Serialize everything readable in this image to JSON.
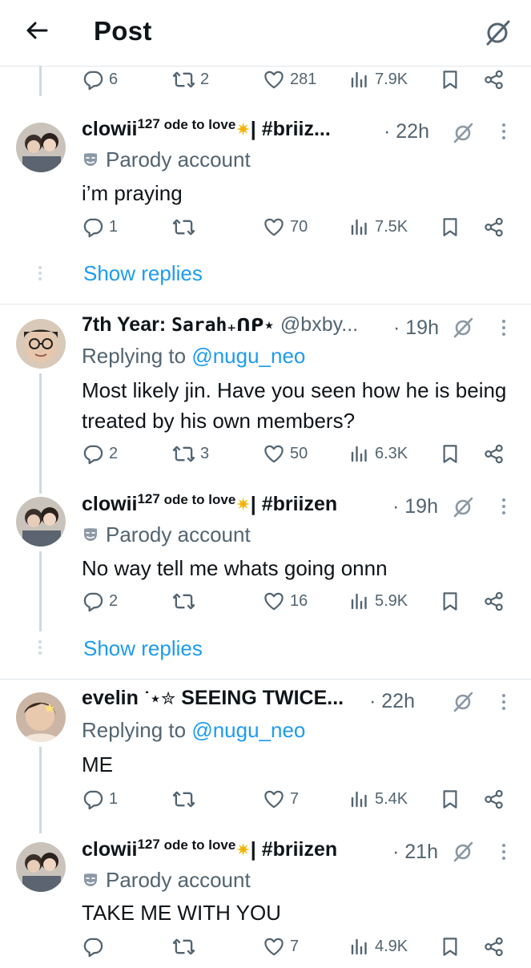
{
  "header": {
    "title": "Post",
    "back_icon": "back-arrow-icon",
    "right_icon": "muted-icon"
  },
  "top_actions": {
    "replies": "6",
    "reposts": "2",
    "likes": "281",
    "views": "7.9K"
  },
  "posts": [
    {
      "name_main": "clowii",
      "name_sup": "127",
      "name_small": " ode to love",
      "name_tail": "| #briiz...",
      "time": "· 22h",
      "sub": "Parody account",
      "text": "i’m praying",
      "replies": "1",
      "reposts": "",
      "likes": "70",
      "views": "7.5K",
      "show_replies": "Show replies"
    },
    {
      "name_main": "7th Year: ",
      "name_fancy": "Sarah",
      "name_fancy2": "₊ᑎᑭ⋆",
      "handle": " @bxby...",
      "time": "· 19h",
      "reply_prefix": "Replying to ",
      "reply_to": "@nugu_neo",
      "text": "Most likely jin. Have you seen how he is being treated by his own members?",
      "replies": "2",
      "reposts": "3",
      "likes": "50",
      "views": "6.3K"
    },
    {
      "name_main": "clowii",
      "name_sup": "127",
      "name_small": " ode to love",
      "name_tail": "| #briizen",
      "time": "· 19h",
      "sub": "Parody account",
      "text": "No way tell me whats going onnn",
      "replies": "2",
      "reposts": "",
      "likes": "16",
      "views": "5.9K",
      "show_replies": "Show replies"
    },
    {
      "name_main": "evelin ",
      "name_deco": "˙⋆✮",
      "name_tail": " SEEING TWICE...",
      "time": "· 22h",
      "reply_prefix": "Replying to ",
      "reply_to": "@nugu_neo",
      "text": "ME",
      "replies": "1",
      "reposts": "",
      "likes": "7",
      "views": "5.4K"
    },
    {
      "name_main": "clowii",
      "name_sup": "127",
      "name_small": " ode to love",
      "name_tail": "| #briizen",
      "time": "· 21h",
      "sub": "Parody account",
      "text": "TAKE ME WITH YOU",
      "replies": "",
      "reposts": "",
      "likes": "7",
      "views": "4.9K"
    }
  ],
  "colors": {
    "link": "#1d9bf0",
    "muted": "#536471",
    "line": "#cfd9de"
  }
}
